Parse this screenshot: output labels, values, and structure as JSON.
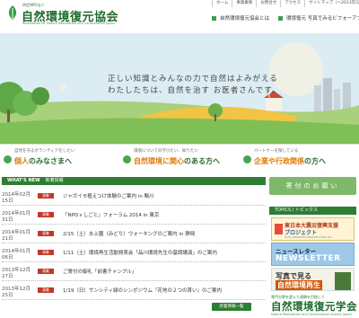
{
  "header": {
    "logo_sub": "特定NPO法人",
    "logo_title": "自然環境復元協会",
    "logo_en": "Association for Nature Restoration and Conservation Japan",
    "top_links": [
      "ホーム",
      "事業概要",
      "お問合せ",
      "アクセス",
      "サイトマップ（〜2013年3月）"
    ],
    "sub_links": [
      "自然環境復元協会とは",
      "環境復元 写真でみるビフォーアフター"
    ]
  },
  "hero": {
    "line1": "正しい知識とみんなの力で自然はよみがえる",
    "line2": "わたしたちは、自然を治す お医者さんです。"
  },
  "features": [
    {
      "small": "自然を守るボランティアをしたい",
      "big_pre": "個人",
      "big_post": "のみなさまへ"
    },
    {
      "small": "環境についての学びたい、知りたい",
      "big_pre": "自然環境に関心",
      "big_post": "のある方へ"
    },
    {
      "small": "パートナーを探している",
      "big_pre": "企業や行政関係",
      "big_post": "の方へ"
    }
  ],
  "news": {
    "title": "WHAT'S NEW",
    "subtitle": "新着情報",
    "items": [
      {
        "date": "2014年02月15日",
        "tag": "募集",
        "text": "ジャガイモ植えつけ体験のご案内 in 鴨川"
      },
      {
        "date": "2014年01月31日",
        "tag": "募集",
        "text": "「NPOｘしごと」フォーラム 2014 in 東京"
      },
      {
        "date": "2014年01月21日",
        "tag": "募集",
        "text": "2/15（土）水上園（みどり）ウォーキングのご案内 in 静岡"
      },
      {
        "date": "2014年01月06日",
        "tag": "募集",
        "text": "1/11（土）環境再生活動発表会「品川環境先生の基調講演」のご案内"
      },
      {
        "date": "2013年12月27日",
        "tag": "募集",
        "text": "ご寄付の御礼「前書チャンプル」"
      },
      {
        "date": "2013年12月25日",
        "tag": "募集",
        "text": "1/19（日）サンシティ緑のシンポジウム『花地の２つの首い』のご案内"
      }
    ],
    "more": "新着情報一覧"
  },
  "sidebar": {
    "donate": "寄付のお願い",
    "topics_title": "TOPICS",
    "topics_sub": "トピックス",
    "banner1_a": "東日本大震災復興支援",
    "banner1_b": "プロジェクト",
    "banner1_c": "EAST JAPAN RECONSTRUCTION AID",
    "banner2_a": "ニュースレター",
    "banner2_b": "NEWSLETTER",
    "banner3_a": "写真で見る",
    "banner3_b": "自然環境再生",
    "banner4_a": "専門分野を超えた連携を目指して",
    "banner4_b": "自然環境復元学会",
    "banner4_c": "Nature Restoration and Conservation Society Japan"
  }
}
